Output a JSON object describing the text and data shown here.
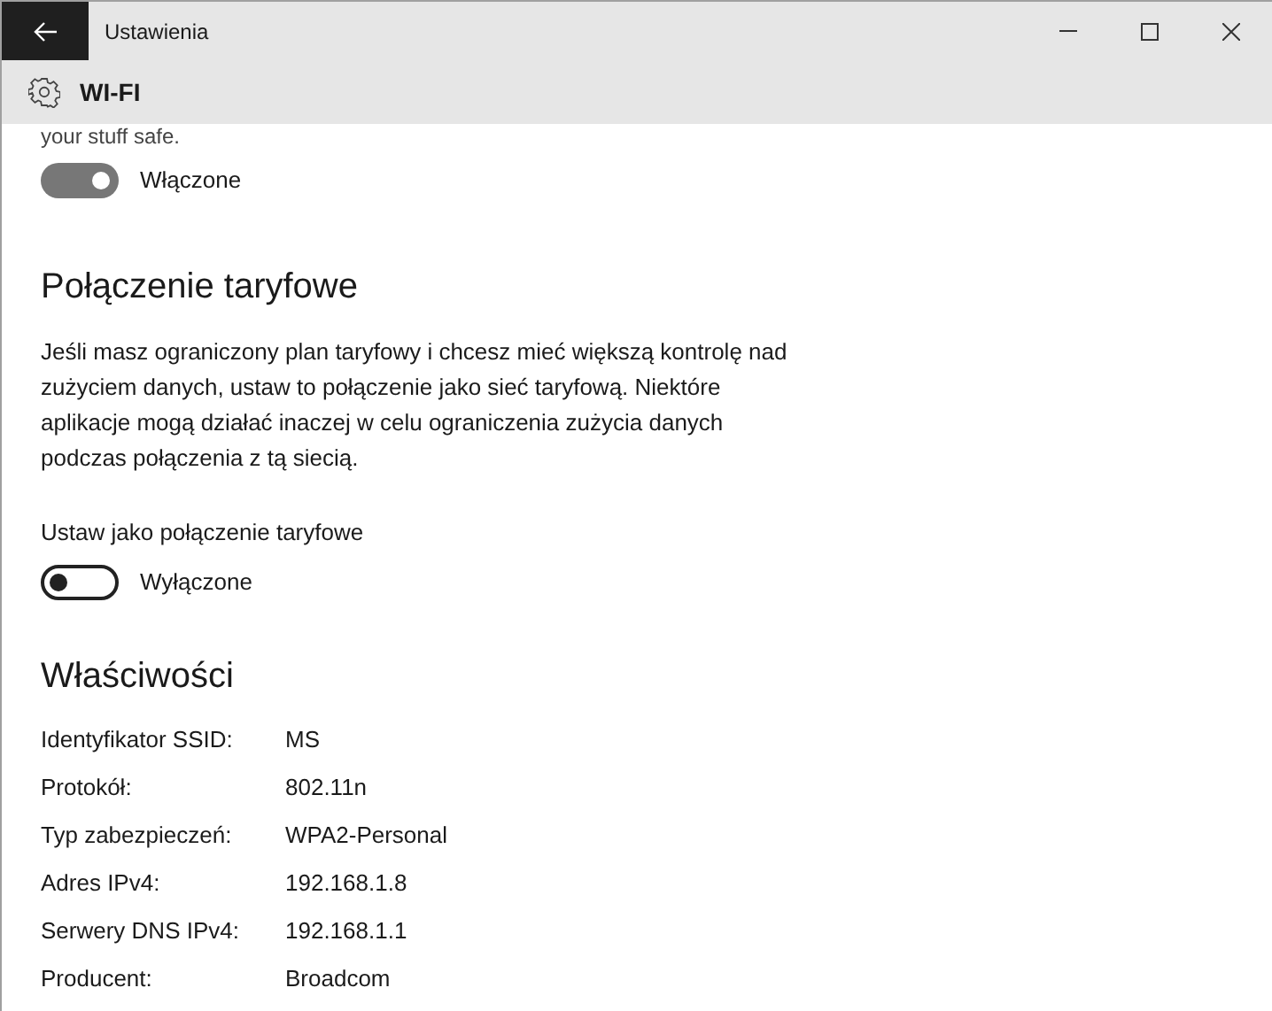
{
  "window": {
    "title": "Ustawienia"
  },
  "page": {
    "title": "WI-FI"
  },
  "cut_text": "your stuff safe.",
  "first_toggle": {
    "on": true,
    "state_label": "Włączone"
  },
  "metered": {
    "heading": "Połączenie taryfowe",
    "description": "Jeśli masz ograniczony plan taryfowy i chcesz mieć większą kontrolę nad zużyciem danych, ustaw to połączenie jako sieć taryfową. Niektóre aplikacje mogą działać inaczej w celu ograniczenia zużycia danych podczas połączenia z tą siecią.",
    "toggle_label": "Ustaw jako połączenie taryfowe",
    "toggle": {
      "on": false,
      "state_label": "Wyłączone"
    }
  },
  "properties": {
    "heading": "Właściwości",
    "rows": [
      {
        "label": "Identyfikator SSID:",
        "value": "MS"
      },
      {
        "label": "Protokół:",
        "value": "802.11n"
      },
      {
        "label": "Typ zabezpieczeń:",
        "value": "WPA2-Personal"
      },
      {
        "label": "Adres IPv4:",
        "value": "192.168.1.8"
      },
      {
        "label": "Serwery DNS IPv4:",
        "value": "192.168.1.1"
      },
      {
        "label": "Producent:",
        "value": "Broadcom"
      }
    ]
  }
}
